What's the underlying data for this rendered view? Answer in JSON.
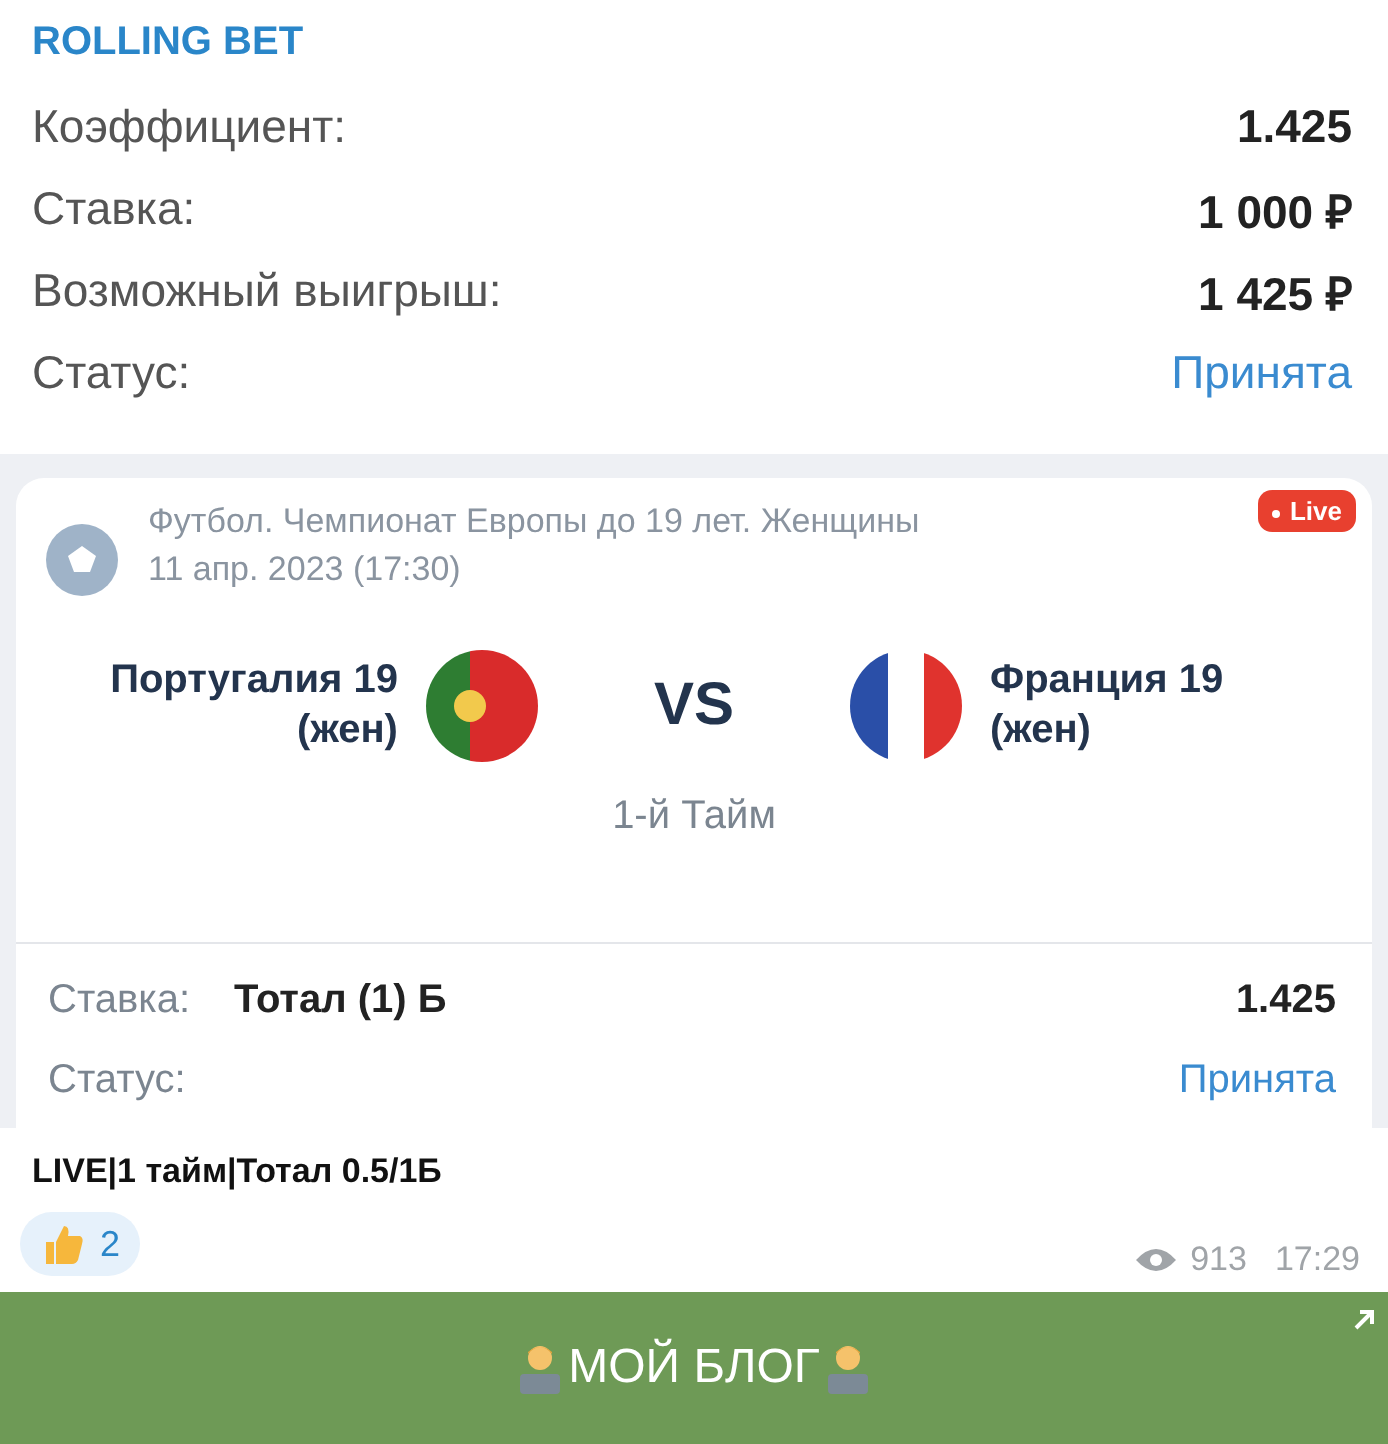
{
  "slip": {
    "title": "ROLLING BET",
    "rows": [
      {
        "label": "Коэффициент:",
        "value": "1.425",
        "kind": "plain"
      },
      {
        "label": "Ставка:",
        "value": "1 000 ₽",
        "kind": "plain"
      },
      {
        "label": "Возможный выигрыш:",
        "value": "1 425 ₽",
        "kind": "plain"
      },
      {
        "label": "Статус:",
        "value": "Принята",
        "kind": "status"
      }
    ]
  },
  "event": {
    "league": "Футбол. Чемпионат Европы до 19 лет. Женщины",
    "date": "11 апр. 2023 (17:30)",
    "badge": "Live",
    "home": {
      "name": "Португалия 19",
      "sub": "(жен)"
    },
    "vs": "VS",
    "away": {
      "name": "Франция 19",
      "sub": "(жен)"
    },
    "period": "1-й Тайм",
    "bet_label": "Ставка:",
    "bet_value": "Тотал (1) Б",
    "bet_odds": "1.425",
    "status_label": "Статус:",
    "status_value": "Принята"
  },
  "caption": "LIVE|1 тайм|Тотал 0.5/1Б",
  "reaction": {
    "count": "2"
  },
  "views": "913",
  "time": "17:29",
  "button": {
    "label": "МОЙ БЛОГ"
  }
}
